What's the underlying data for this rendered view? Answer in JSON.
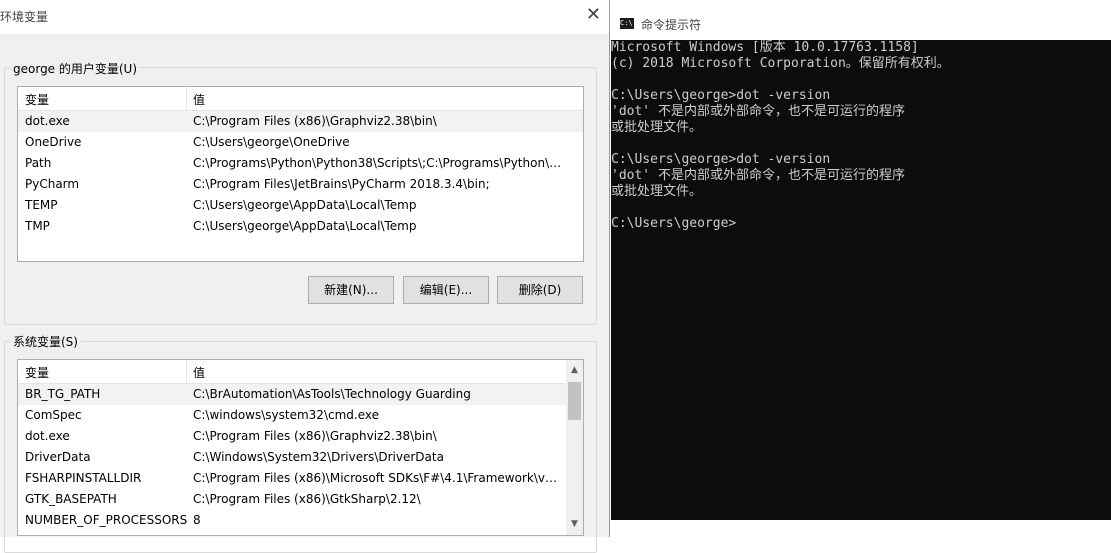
{
  "env_dialog": {
    "title": "环境变量",
    "close_icon": "close-icon",
    "user_vars": {
      "group_label": "george 的用户变量(U)",
      "col_variable": "变量",
      "col_value": "值",
      "rows": [
        {
          "name": "dot.exe",
          "value": "C:\\Program Files (x86)\\Graphviz2.38\\bin\\"
        },
        {
          "name": "OneDrive",
          "value": "C:\\Users\\george\\OneDrive"
        },
        {
          "name": "Path",
          "value": "C:\\Programs\\Python\\Python38\\Scripts\\;C:\\Programs\\Python\\P..."
        },
        {
          "name": "PyCharm",
          "value": "C:\\Program Files\\JetBrains\\PyCharm 2018.3.4\\bin;"
        },
        {
          "name": "TEMP",
          "value": "C:\\Users\\george\\AppData\\Local\\Temp"
        },
        {
          "name": "TMP",
          "value": "C:\\Users\\george\\AppData\\Local\\Temp"
        }
      ],
      "new_label": "新建(N)...",
      "edit_label": "编辑(E)...",
      "delete_label": "删除(D)"
    },
    "system_vars": {
      "group_label": "系统变量(S)",
      "col_variable": "变量",
      "col_value": "值",
      "rows": [
        {
          "name": "BR_TG_PATH",
          "value": "C:\\BrAutomation\\AsTools\\Technology Guarding"
        },
        {
          "name": "ComSpec",
          "value": "C:\\windows\\system32\\cmd.exe"
        },
        {
          "name": "dot.exe",
          "value": "C:\\Program Files (x86)\\Graphviz2.38\\bin\\"
        },
        {
          "name": "DriverData",
          "value": "C:\\Windows\\System32\\Drivers\\DriverData"
        },
        {
          "name": "FSHARPINSTALLDIR",
          "value": "C:\\Program Files (x86)\\Microsoft SDKs\\F#\\4.1\\Framework\\v4...."
        },
        {
          "name": "GTK_BASEPATH",
          "value": "C:\\Program Files (x86)\\GtkSharp\\2.12\\"
        },
        {
          "name": "NUMBER_OF_PROCESSORS",
          "value": "8"
        }
      ]
    }
  },
  "cmd_window": {
    "title": "命令提示符",
    "icon_text": "C:\\",
    "lines": [
      "Microsoft Windows [版本 10.0.17763.1158]",
      "(c) 2018 Microsoft Corporation。保留所有权利。",
      "",
      "C:\\Users\\george>dot -version",
      "'dot' 不是内部或外部命令，也不是可运行的程序",
      "或批处理文件。",
      "",
      "C:\\Users\\george>dot -version",
      "'dot' 不是内部或外部命令，也不是可运行的程序",
      "或批处理文件。",
      "",
      "C:\\Users\\george>"
    ],
    "colors": {
      "console_bg": "#0c0c0c",
      "console_text": "#cccccc"
    }
  }
}
